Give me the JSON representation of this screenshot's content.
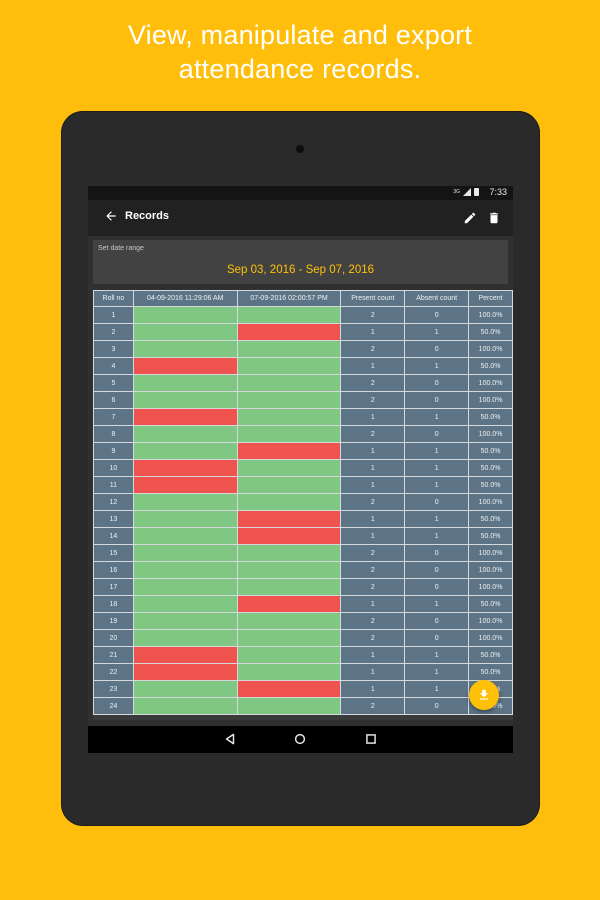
{
  "headline": {
    "line1": "View, manipulate and export",
    "line2": "attendance records."
  },
  "status_bar": {
    "network": "3G",
    "time": "7:33"
  },
  "app_bar": {
    "title": "Records"
  },
  "date_range": {
    "label": "Set date range",
    "value": "Sep 03, 2016 - Sep 07, 2016"
  },
  "table": {
    "headers": [
      "Roll no",
      "04-09-2016 11:29:06 AM",
      "07-09-2016 02:00:57 PM",
      "Present count",
      "Absent count",
      "Percent"
    ],
    "rows": [
      {
        "roll": "1",
        "s1": "present",
        "s2": "present",
        "present_count": "2",
        "absent_count": "0",
        "percent": "100.0%"
      },
      {
        "roll": "2",
        "s1": "present",
        "s2": "absent",
        "present_count": "1",
        "absent_count": "1",
        "percent": "50.0%"
      },
      {
        "roll": "3",
        "s1": "present",
        "s2": "present",
        "present_count": "2",
        "absent_count": "0",
        "percent": "100.0%"
      },
      {
        "roll": "4",
        "s1": "absent",
        "s2": "present",
        "present_count": "1",
        "absent_count": "1",
        "percent": "50.0%"
      },
      {
        "roll": "5",
        "s1": "present",
        "s2": "present",
        "present_count": "2",
        "absent_count": "0",
        "percent": "100.0%"
      },
      {
        "roll": "6",
        "s1": "present",
        "s2": "present",
        "present_count": "2",
        "absent_count": "0",
        "percent": "100.0%"
      },
      {
        "roll": "7",
        "s1": "absent",
        "s2": "present",
        "present_count": "1",
        "absent_count": "1",
        "percent": "50.0%"
      },
      {
        "roll": "8",
        "s1": "present",
        "s2": "present",
        "present_count": "2",
        "absent_count": "0",
        "percent": "100.0%"
      },
      {
        "roll": "9",
        "s1": "present",
        "s2": "absent",
        "present_count": "1",
        "absent_count": "1",
        "percent": "50.0%"
      },
      {
        "roll": "10",
        "s1": "absent",
        "s2": "present",
        "present_count": "1",
        "absent_count": "1",
        "percent": "50.0%"
      },
      {
        "roll": "11",
        "s1": "absent",
        "s2": "present",
        "present_count": "1",
        "absent_count": "1",
        "percent": "50.0%"
      },
      {
        "roll": "12",
        "s1": "present",
        "s2": "present",
        "present_count": "2",
        "absent_count": "0",
        "percent": "100.0%"
      },
      {
        "roll": "13",
        "s1": "present",
        "s2": "absent",
        "present_count": "1",
        "absent_count": "1",
        "percent": "50.0%"
      },
      {
        "roll": "14",
        "s1": "present",
        "s2": "absent",
        "present_count": "1",
        "absent_count": "1",
        "percent": "50.0%"
      },
      {
        "roll": "15",
        "s1": "present",
        "s2": "present",
        "present_count": "2",
        "absent_count": "0",
        "percent": "100.0%"
      },
      {
        "roll": "16",
        "s1": "present",
        "s2": "present",
        "present_count": "2",
        "absent_count": "0",
        "percent": "100.0%"
      },
      {
        "roll": "17",
        "s1": "present",
        "s2": "present",
        "present_count": "2",
        "absent_count": "0",
        "percent": "100.0%"
      },
      {
        "roll": "18",
        "s1": "present",
        "s2": "absent",
        "present_count": "1",
        "absent_count": "1",
        "percent": "50.0%"
      },
      {
        "roll": "19",
        "s1": "present",
        "s2": "present",
        "present_count": "2",
        "absent_count": "0",
        "percent": "100.0%"
      },
      {
        "roll": "20",
        "s1": "present",
        "s2": "present",
        "present_count": "2",
        "absent_count": "0",
        "percent": "100.0%"
      },
      {
        "roll": "21",
        "s1": "absent",
        "s2": "present",
        "present_count": "1",
        "absent_count": "1",
        "percent": "50.0%"
      },
      {
        "roll": "22",
        "s1": "absent",
        "s2": "present",
        "present_count": "1",
        "absent_count": "1",
        "percent": "50.0%"
      },
      {
        "roll": "23",
        "s1": "present",
        "s2": "absent",
        "present_count": "1",
        "absent_count": "1",
        "percent": "50.0%"
      },
      {
        "roll": "24",
        "s1": "present",
        "s2": "present",
        "present_count": "2",
        "absent_count": "0",
        "percent": "100.0%"
      }
    ]
  },
  "icons": {
    "back": "arrow-left-icon",
    "edit": "pencil-icon",
    "delete": "trash-icon",
    "export": "download-icon",
    "nav_back": "triangle-back-icon",
    "nav_home": "circle-home-icon",
    "nav_recents": "square-recents-icon"
  },
  "colors": {
    "background": "#FFBE0B",
    "accent": "#FFC107",
    "present": "#81C784",
    "absent": "#EF5350",
    "cell": "#5D7486"
  }
}
